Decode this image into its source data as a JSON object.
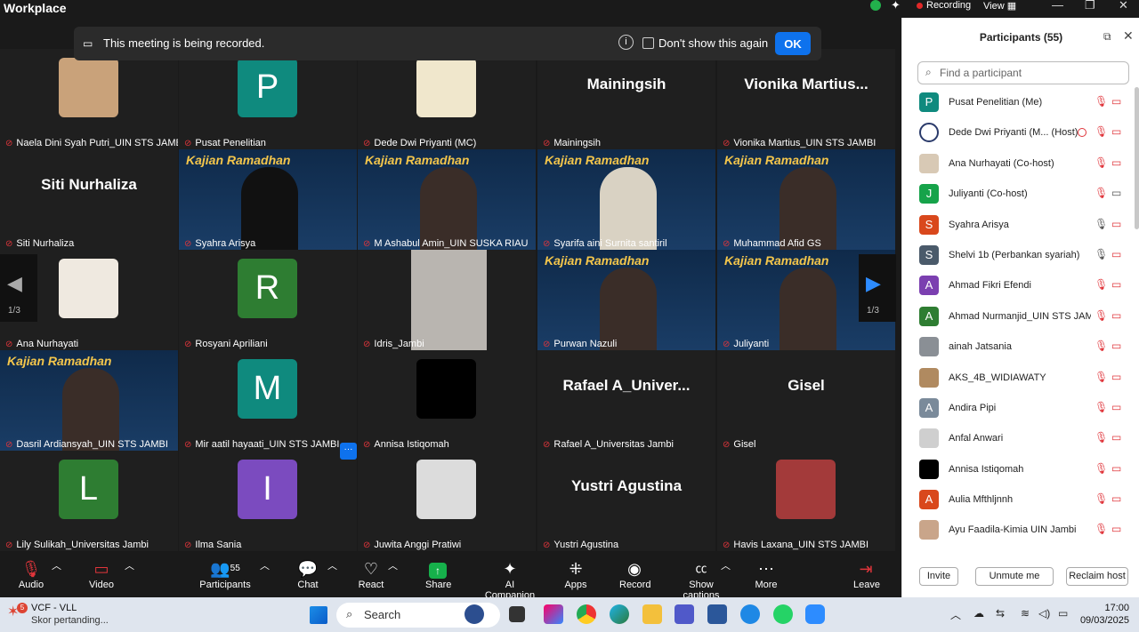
{
  "titlebar": {
    "app": "Workplace",
    "recording": "Recording",
    "view": "View"
  },
  "banner": {
    "text": "This meeting is being recorded.",
    "dont_show": "Don't show this again",
    "ok": "OK"
  },
  "gallery": {
    "page_left": "1/3",
    "page_right": "1/3",
    "more": "···",
    "tiles": [
      {
        "name": "Naela Dini Syah Putri_UIN STS JAMBI"
      },
      {
        "name": "Pusat Penelitian",
        "initial": "P",
        "color": "#0f8a7e"
      },
      {
        "name": "Dede Dwi Priyanti (MC)"
      },
      {
        "name": "Mainingsih",
        "big": "Mainingsih"
      },
      {
        "name": "Vionika Martius_UIN STS JAMBI",
        "big": "Vionika  Martius..."
      },
      {
        "name": "Siti Nurhaliza",
        "big": "Siti Nurhaliza"
      },
      {
        "name": "Syahra Arisya"
      },
      {
        "name": "M Ashabul Amin_UIN SUSKA RIAU"
      },
      {
        "name": "Syarifa aini Surnita santiril"
      },
      {
        "name": "Muhammad Afid GS"
      },
      {
        "name": "Ana Nurhayati"
      },
      {
        "name": "Rosyani Apriliani",
        "initial": "R",
        "color": "#2e7d32"
      },
      {
        "name": "Idris_Jambi"
      },
      {
        "name": "Purwan Nazuli"
      },
      {
        "name": "Juliyanti"
      },
      {
        "name": "Dasril Ardiansyah_UIN STS JAMBI"
      },
      {
        "name": "Mir aatil hayaati_UIN STS JAMBI",
        "initial": "M",
        "color": "#0f8a7e"
      },
      {
        "name": "Annisa Istiqomah"
      },
      {
        "name": "Rafael A_Universitas Jambi",
        "big": "Rafael  A_Univer..."
      },
      {
        "name": "Gisel",
        "big": "Gisel"
      },
      {
        "name": "Lily Sulikah_Universitas Jambi",
        "initial": "L",
        "color": "#2e7d32"
      },
      {
        "name": "Ilma Sania",
        "initial": "I",
        "color": "#7b4bbf"
      },
      {
        "name": "Juwita Anggi Pratiwi"
      },
      {
        "name": "Yustri Agustina",
        "big": "Yustri Agustina"
      },
      {
        "name": "Havis Laxana_UIN STS JAMBI"
      }
    ],
    "video_banner": "Kajian Ramadhan"
  },
  "toolbar": {
    "audio": "Audio",
    "video": "Video",
    "participants": "Participants",
    "participants_count": "55",
    "chat": "Chat",
    "react": "React",
    "share": "Share",
    "ai": "AI Companion",
    "apps": "Apps",
    "record": "Record",
    "captions": "Show captions",
    "more": "More",
    "leave": "Leave"
  },
  "panel": {
    "title": "Participants (55)",
    "search_placeholder": "Find a participant",
    "participants": [
      {
        "name": "Pusat Penelitian (Me)",
        "initial": "P",
        "color": "#0f8a7e",
        "mic": "muted",
        "cam": "off"
      },
      {
        "name": "Dede Dwi Priyanti (M... (Host)",
        "initial": "",
        "color": "#2a3a6a",
        "mic": "muted",
        "cam": "off",
        "host": true
      },
      {
        "name": "Ana Nurhayati (Co-host)",
        "initial": "",
        "color": "#d8c9b5",
        "mic": "muted",
        "cam": "off"
      },
      {
        "name": "Juliyanti (Co-host)",
        "initial": "J",
        "color": "#16a34a",
        "mic": "muted",
        "cam": "on"
      },
      {
        "name": "Syahra Arisya",
        "initial": "S",
        "color": "#d9481c",
        "mic": "on",
        "cam": "off"
      },
      {
        "name": "Shelvi 1b (Perbankan syariah)",
        "initial": "S",
        "color": "#4a5a6a",
        "mic": "on",
        "cam": "off"
      },
      {
        "name": "Ahmad Fikri Efendi",
        "initial": "A",
        "color": "#7b3fb0",
        "mic": "muted",
        "cam": "off"
      },
      {
        "name": "Ahmad Nurmanjid_UIN STS JAM...",
        "initial": "A",
        "color": "#2e7d32",
        "mic": "muted",
        "cam": "off"
      },
      {
        "name": "ainah Jatsania",
        "initial": "",
        "color": "#8a8f95",
        "mic": "muted",
        "cam": "off"
      },
      {
        "name": "AKS_4B_WIDIAWATY",
        "initial": "",
        "color": "#b08a60",
        "mic": "muted",
        "cam": "off"
      },
      {
        "name": "Andira Pipi",
        "initial": "A",
        "color": "#7a8a9a",
        "mic": "muted",
        "cam": "off"
      },
      {
        "name": "Anfal Anwari",
        "initial": "",
        "color": "#cfcfcf",
        "mic": "muted",
        "cam": "off"
      },
      {
        "name": "Annisa Istiqomah",
        "initial": "",
        "color": "#000000",
        "mic": "muted",
        "cam": "off"
      },
      {
        "name": "Aulia Mfthljnnh",
        "initial": "A",
        "color": "#d9481c",
        "mic": "muted",
        "cam": "off"
      },
      {
        "name": "Ayu Faadila-Kimia UIN Jambi",
        "initial": "",
        "color": "#c9a58a",
        "mic": "muted",
        "cam": "off"
      }
    ],
    "invite": "Invite",
    "unmute_me": "Unmute me",
    "reclaim_host": "Reclaim host"
  },
  "taskbar": {
    "notif_count": "5",
    "widget_title": "VCF - VLL",
    "widget_sub": "Skor pertanding...",
    "search": "Search",
    "time": "17:00",
    "date": "09/03/2025"
  }
}
